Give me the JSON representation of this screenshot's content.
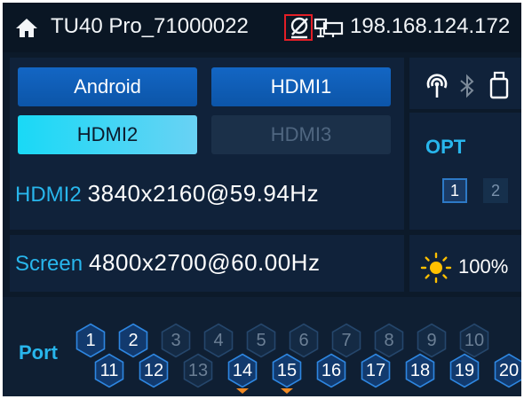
{
  "header": {
    "device_name": "TU40 Pro_71000022",
    "ip": "198.168.124.172",
    "icons": [
      "home-icon",
      "no-link-icon",
      "lan-icon"
    ]
  },
  "sources": {
    "buttons": [
      {
        "label": "Android",
        "state": "available"
      },
      {
        "label": "HDMI1",
        "state": "available"
      },
      {
        "label": "HDMI2",
        "state": "selected"
      },
      {
        "label": "HDMI3",
        "state": "disabled"
      }
    ]
  },
  "input_resolution": {
    "label": "HDMI2",
    "value": "3840x2160@59.94Hz"
  },
  "screen_resolution": {
    "label": "Screen",
    "value": "4800x2700@60.00Hz"
  },
  "connectivity": {
    "icons": [
      "wifi-signal-icon",
      "bluetooth-icon",
      "usb-drive-icon"
    ]
  },
  "opt": {
    "title": "OPT",
    "ports": [
      "1",
      "2"
    ],
    "selected": "1"
  },
  "brightness": {
    "icon": "sun-icon",
    "value": "100%"
  },
  "ports": {
    "label": "Port",
    "items": [
      {
        "n": "1",
        "active": true,
        "marker": false
      },
      {
        "n": "2",
        "active": true,
        "marker": false
      },
      {
        "n": "3",
        "active": false,
        "marker": false
      },
      {
        "n": "4",
        "active": false,
        "marker": false
      },
      {
        "n": "5",
        "active": false,
        "marker": false
      },
      {
        "n": "6",
        "active": false,
        "marker": false
      },
      {
        "n": "7",
        "active": false,
        "marker": false
      },
      {
        "n": "8",
        "active": false,
        "marker": false
      },
      {
        "n": "9",
        "active": false,
        "marker": false
      },
      {
        "n": "10",
        "active": false,
        "marker": false
      },
      {
        "n": "11",
        "active": true,
        "marker": false
      },
      {
        "n": "12",
        "active": true,
        "marker": false
      },
      {
        "n": "13",
        "active": false,
        "marker": false
      },
      {
        "n": "14",
        "active": true,
        "marker": true
      },
      {
        "n": "15",
        "active": true,
        "marker": true
      },
      {
        "n": "16",
        "active": true,
        "marker": false
      },
      {
        "n": "17",
        "active": true,
        "marker": false
      },
      {
        "n": "18",
        "active": true,
        "marker": false
      },
      {
        "n": "19",
        "active": true,
        "marker": false
      },
      {
        "n": "20",
        "active": true,
        "marker": false
      }
    ]
  },
  "colors": {
    "background": "#0c1a2a",
    "panel": "#10223a",
    "accent_cyan": "#28b6ec",
    "button_blue": "#1366c4",
    "selected_button": "#19d9f6",
    "highlight_box": "#e21e26",
    "marker_orange": "#f08a24"
  }
}
